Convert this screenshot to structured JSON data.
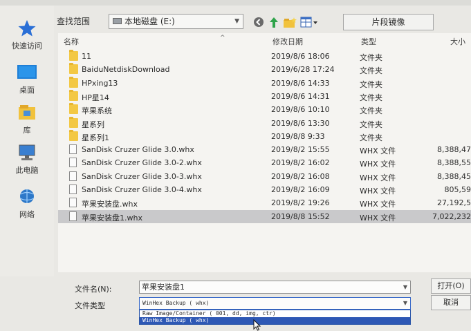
{
  "sidebar": {
    "items": [
      {
        "label": "快速访问",
        "icon": "star-icon"
      },
      {
        "label": "桌面",
        "icon": "desktop-icon"
      },
      {
        "label": "库",
        "icon": "library-icon"
      },
      {
        "label": "此电脑",
        "icon": "computer-icon"
      },
      {
        "label": "网络",
        "icon": "network-icon"
      }
    ]
  },
  "toolbar": {
    "look_in_label": "查找范围",
    "location": "本地磁盘 (E:)",
    "location_icon": "drive-icon",
    "snapshot_button": "片段镜像",
    "icons": [
      "back-icon",
      "up-folder-icon",
      "new-folder-icon",
      "view-menu-icon"
    ]
  },
  "columns": {
    "name": "名称",
    "date": "修改日期",
    "type": "类型",
    "size": "大小"
  },
  "files": [
    {
      "name": "11",
      "date": "2019/8/6 18:06",
      "type": "文件夹",
      "size": "",
      "kind": "folder"
    },
    {
      "name": "BaiduNetdiskDownload",
      "date": "2019/6/28 17:24",
      "type": "文件夹",
      "size": "",
      "kind": "folder"
    },
    {
      "name": "HPxing13",
      "date": "2019/8/6 14:33",
      "type": "文件夹",
      "size": "",
      "kind": "folder"
    },
    {
      "name": "HP星14",
      "date": "2019/8/6 14:31",
      "type": "文件夹",
      "size": "",
      "kind": "folder"
    },
    {
      "name": "苹果系统",
      "date": "2019/8/6 10:10",
      "type": "文件夹",
      "size": "",
      "kind": "folder"
    },
    {
      "name": "星系列",
      "date": "2019/8/6 13:30",
      "type": "文件夹",
      "size": "",
      "kind": "folder"
    },
    {
      "name": "星系列1",
      "date": "2019/8/8 9:33",
      "type": "文件夹",
      "size": "",
      "kind": "folder"
    },
    {
      "name": "SanDisk Cruzer Glide 3.0.whx",
      "date": "2019/8/2 15:55",
      "type": "WHX 文件",
      "size": "8,388,47",
      "kind": "file"
    },
    {
      "name": "SanDisk Cruzer Glide 3.0-2.whx",
      "date": "2019/8/2 16:02",
      "type": "WHX 文件",
      "size": "8,388,55",
      "kind": "file"
    },
    {
      "name": "SanDisk Cruzer Glide 3.0-3.whx",
      "date": "2019/8/2 16:08",
      "type": "WHX 文件",
      "size": "8,388,45",
      "kind": "file"
    },
    {
      "name": "SanDisk Cruzer Glide 3.0-4.whx",
      "date": "2019/8/2 16:09",
      "type": "WHX 文件",
      "size": "805,59",
      "kind": "file"
    },
    {
      "name": "苹果安装盘.whx",
      "date": "2019/8/2 19:26",
      "type": "WHX 文件",
      "size": "27,192,5",
      "kind": "file"
    },
    {
      "name": "苹果安装盘1.whx",
      "date": "2019/8/8 15:52",
      "type": "WHX 文件",
      "size": "7,022,232",
      "kind": "file",
      "selected": true
    }
  ],
  "footer": {
    "filename_label": "文件名(N):",
    "filename_value": "苹果安装盘1",
    "filetype_label": "文件类型",
    "filetype_value": "WinHex Backup ( whx)",
    "filetype_options": [
      "Raw Image/Container ( 001, dd, img, ctr)",
      "WinHex Backup ( whx)"
    ],
    "open_button": "打开(O)",
    "cancel_button": "取消"
  }
}
